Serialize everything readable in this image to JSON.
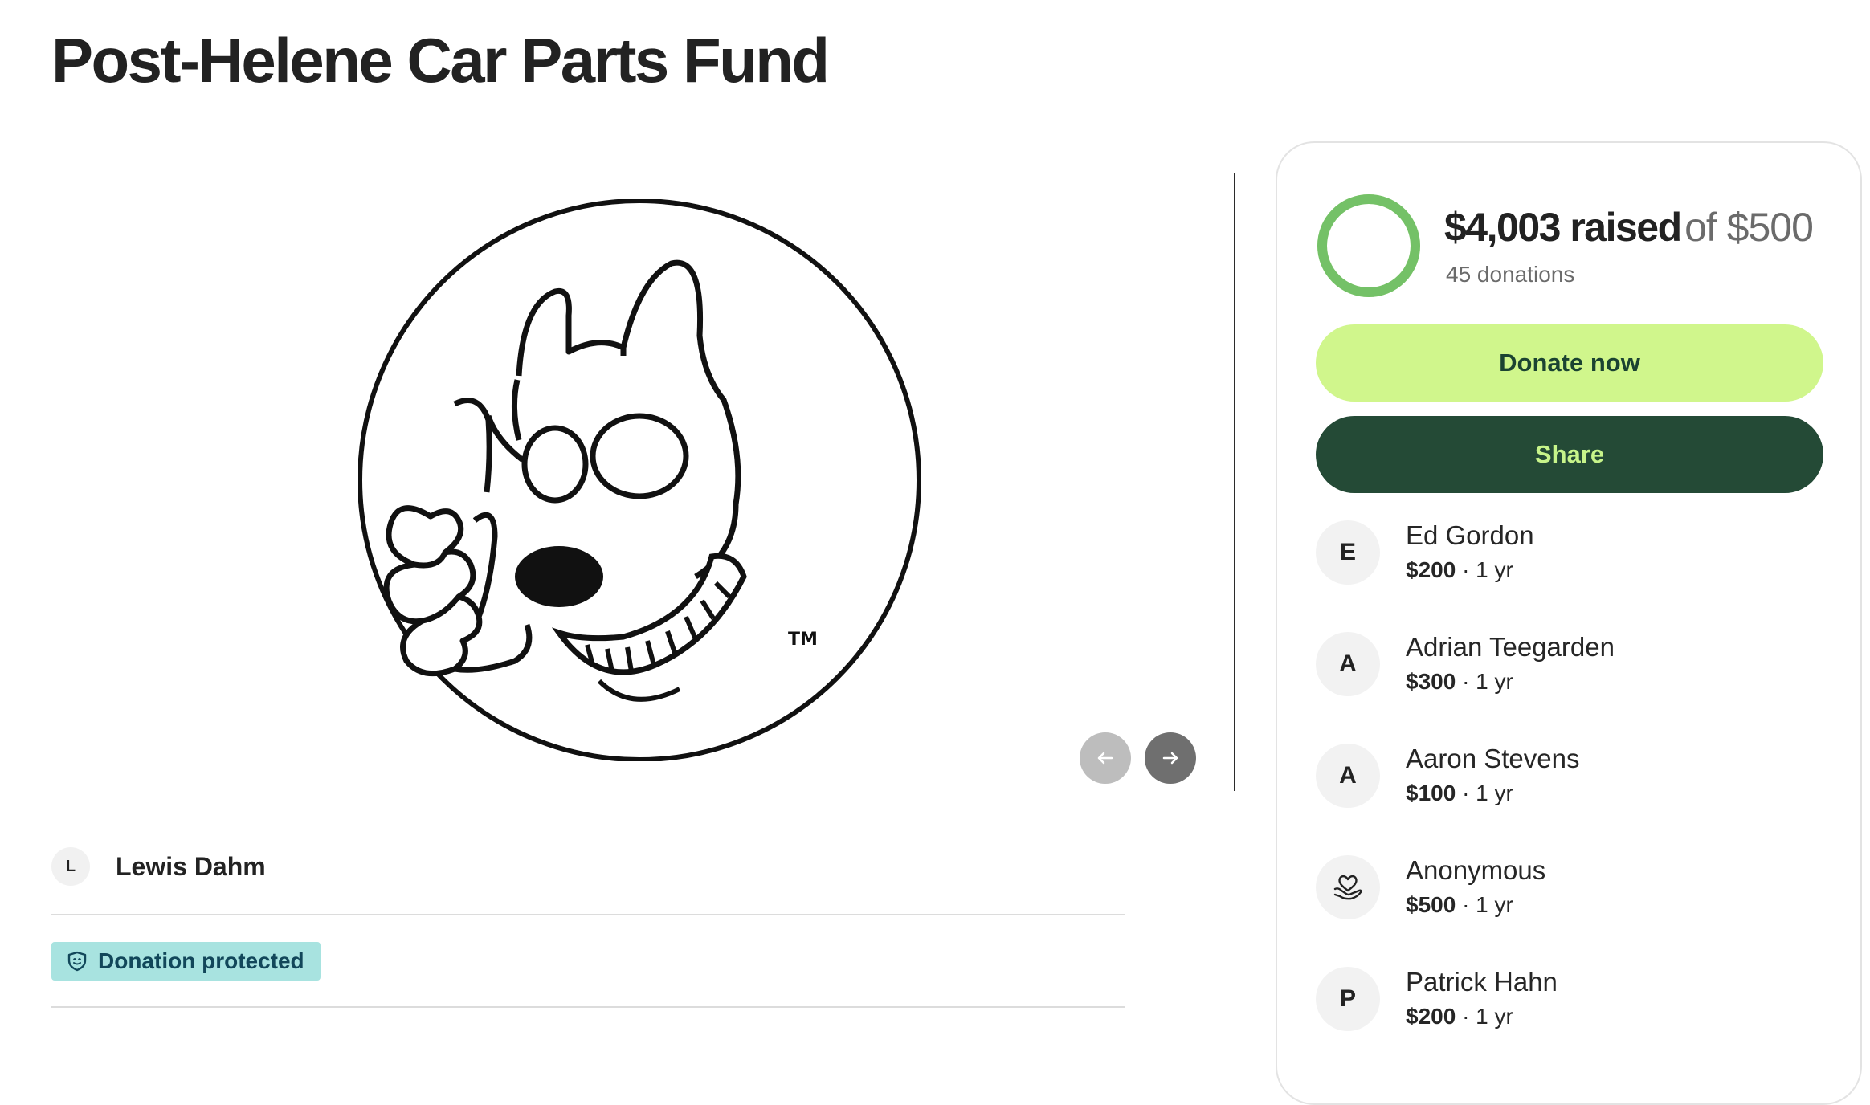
{
  "title": "Post-Helene Car Parts Fund",
  "media": {
    "image_name": "thumbs-up-dog-logo",
    "trademark": "TM",
    "prev_icon": "arrow-left-icon",
    "next_icon": "arrow-right-icon"
  },
  "organizer": {
    "initial": "L",
    "name": "Lewis Dahm"
  },
  "badge": {
    "label": "Donation protected",
    "icon": "shield-icon"
  },
  "fundraiser": {
    "raised": "$4,003 raised",
    "goal": "of $500",
    "donations": "45 donations",
    "progress_fraction": 1.0
  },
  "actions": {
    "donate_label": "Donate now",
    "share_label": "Share"
  },
  "donors": [
    {
      "initial": "E",
      "name": "Ed Gordon",
      "amount": "$200",
      "period": " · 1 yr"
    },
    {
      "initial": "A",
      "name": "Adrian Teegarden",
      "amount": "$300",
      "period": " · 1 yr"
    },
    {
      "initial": "A",
      "name": "Aaron Stevens",
      "amount": "$100",
      "period": " · 1 yr"
    },
    {
      "initial": "",
      "icon": "heart-hand-icon",
      "name": "Anonymous",
      "amount": "$500",
      "period": " · 1 yr"
    },
    {
      "initial": "P",
      "name": "Patrick Hahn",
      "amount": "$200",
      "period": " · 1 yr"
    }
  ],
  "colors": {
    "progress_ring": "#74c167",
    "donate_button": "#d0f68c",
    "share_button": "#244a36",
    "badge_background": "#a8e3e0"
  }
}
